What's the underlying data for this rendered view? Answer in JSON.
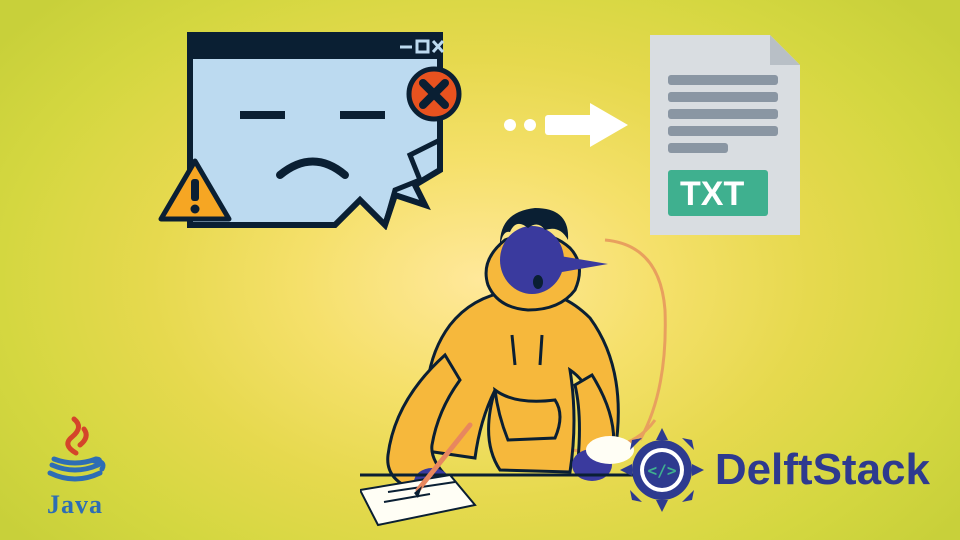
{
  "illustration": {
    "broken_window": {
      "face": "annoyed"
    },
    "warning_icon": {
      "glyph": "!"
    },
    "close_icon": {
      "glyph": "×"
    },
    "arrow_direction": "right",
    "document": {
      "badge_text": "TXT"
    },
    "person": {
      "action": "writing"
    }
  },
  "logos": {
    "java": {
      "label": "Java"
    },
    "delftstack": {
      "label": "DelftStack",
      "badge": "</>"
    }
  },
  "colors": {
    "bg_center": "#ffe89a",
    "bg_edge": "#c8d03a",
    "window": "#bcdaf0",
    "outline": "#0a1f33",
    "warn": "#f6a623",
    "close": "#e8521f",
    "doc": "#d9dde1",
    "txt_badge": "#3fb08f",
    "skin": "#3a3a9e",
    "hood": "#f6b83c",
    "java_red": "#d4442a",
    "java_blue": "#2e6db4",
    "delft": "#2e3a8f"
  }
}
